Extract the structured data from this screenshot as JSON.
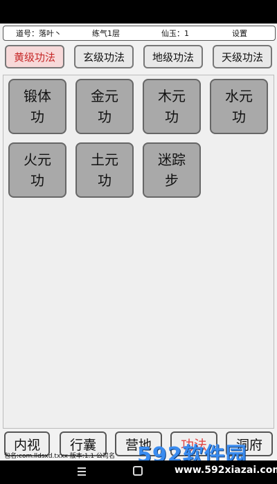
{
  "topbar": {
    "account": "道号：落叶丶",
    "realm": "练气1层",
    "jade": "仙玉：1",
    "settings": "设置"
  },
  "tabs": [
    {
      "label": "黄级功法",
      "active": true
    },
    {
      "label": "玄级功法",
      "active": false
    },
    {
      "label": "地级功法",
      "active": false
    },
    {
      "label": "天级功法",
      "active": false
    }
  ],
  "skills": [
    {
      "label": "锻体\n功"
    },
    {
      "label": "金元\n功"
    },
    {
      "label": "木元\n功"
    },
    {
      "label": "水元\n功"
    },
    {
      "label": "火元\n功"
    },
    {
      "label": "土元\n功"
    },
    {
      "label": "迷踪\n步"
    }
  ],
  "bottom_nav": [
    {
      "label": "内视",
      "active": false
    },
    {
      "label": "行囊",
      "active": false
    },
    {
      "label": "营地",
      "active": false
    },
    {
      "label": "功法",
      "active": true
    },
    {
      "label": "洞府",
      "active": false
    }
  ],
  "footer": {
    "package_line": "包名:com.lldsxd.txxx  版本:1.1  公司名"
  },
  "watermark": {
    "logo": "592软件园",
    "url": "www.592xiazai.com"
  },
  "colors": {
    "active_tab_text": "#c62828",
    "active_tab_bg": "#f7d9d9",
    "skill_button_bg": "#a9a9a9",
    "active_nav_text": "#e04444"
  }
}
